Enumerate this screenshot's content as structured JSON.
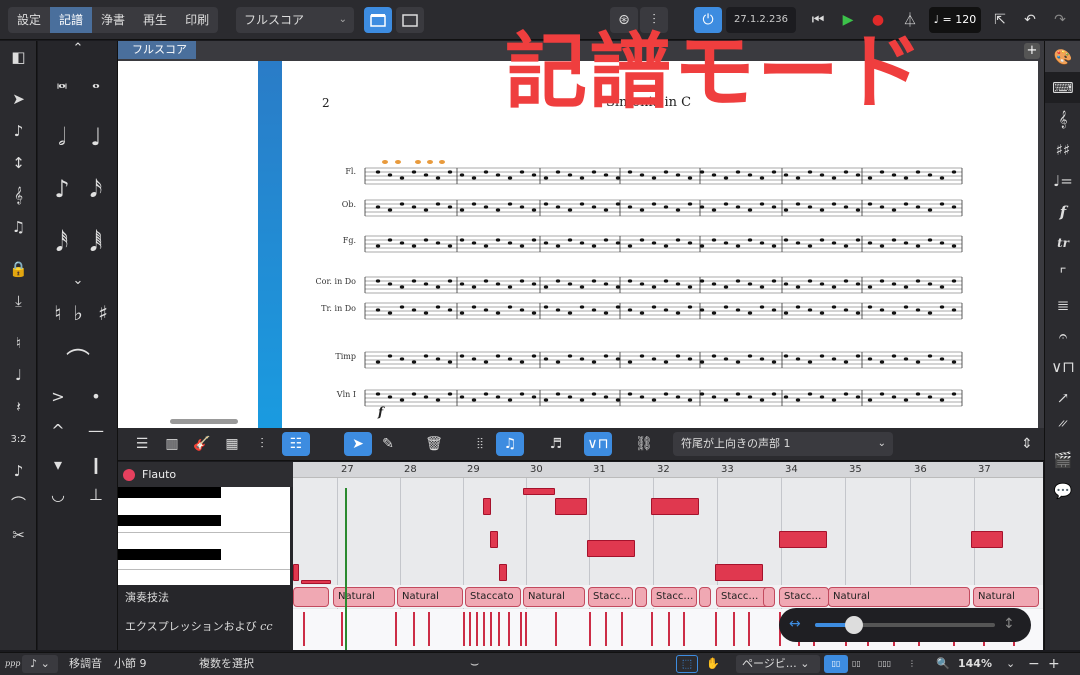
{
  "toolbar": {
    "modes": [
      "設定",
      "記譜",
      "浄書",
      "再生",
      "印刷"
    ],
    "active_mode": "記譜",
    "layout": "フルスコア",
    "time": "27.1.2.236",
    "tempo": "= 120"
  },
  "overlay": {
    "text": "記譜モード"
  },
  "document": {
    "tab": "フルスコア",
    "page_number": "2",
    "title": "Sinfonia in C",
    "instruments": [
      "Fl.",
      "Ob.",
      "Fg.",
      "Cor. in Do",
      "Tr. in Do",
      "Timp",
      "Vln I"
    ],
    "dynamic": "f"
  },
  "key_editor": {
    "voice": "符尾が上向きの声部 1",
    "instrument": "Flauto",
    "lane_techniques": "演奏技法",
    "lane_expression": "エクスプレッションおよび ",
    "bars": [
      "27",
      "28",
      "29",
      "30",
      "31",
      "32",
      "33",
      "34",
      "35",
      "36",
      "37"
    ],
    "techniques": [
      "Natural",
      "Natural",
      "Staccato",
      "Natural",
      "Stacc…",
      "Stacc…",
      "Stacc…",
      "Stacc…",
      "Natural",
      "Natural"
    ]
  },
  "status": {
    "dynamic": "ppp",
    "transpose": "移調音",
    "bar": "小節 9",
    "select": "複数を選択",
    "view": "ページビ…",
    "zoom": "144%"
  },
  "colors": {
    "accent": "#3d8ce0",
    "note": "#e0384f",
    "overlay": "#ef3e3e"
  }
}
